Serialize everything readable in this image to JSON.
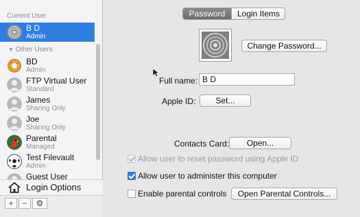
{
  "sidebar": {
    "current_user_label": "Current User",
    "other_users_label": "Other Users",
    "current_user": {
      "name": "B D",
      "role": "Admin",
      "avatar": "spiral-stone-avatar"
    },
    "other_users": [
      {
        "name": "BD",
        "role": "Admin",
        "avatar": "donut-avatar"
      },
      {
        "name": "FTP Virtual User",
        "role": "Standard",
        "avatar": "generic-person-avatar"
      },
      {
        "name": "James",
        "role": "Sharing Only",
        "avatar": "generic-person-avatar"
      },
      {
        "name": "Joe",
        "role": "Sharing Only",
        "avatar": "generic-person-avatar"
      },
      {
        "name": "Parental",
        "role": "Managed",
        "avatar": "parrot-avatar"
      },
      {
        "name": "Test Filevault",
        "role": "Admin",
        "avatar": "soccer-ball-avatar"
      },
      {
        "name": "Guest User",
        "role": "",
        "avatar": "generic-person-avatar"
      }
    ],
    "login_options_label": "Login Options",
    "add_label": "+",
    "remove_label": "−",
    "gear_label": "⚙"
  },
  "tabs": {
    "password": "Password",
    "login_items": "Login Items",
    "selected": "Password"
  },
  "main": {
    "change_password_label": "Change Password...",
    "full_name_label": "Full name:",
    "full_name_value": "B D",
    "apple_id_label": "Apple ID:",
    "set_label": "Set...",
    "contacts_card_label": "Contacts Card:",
    "open_label": "Open...",
    "allow_reset_label": "Allow user to reset password using Apple ID",
    "allow_reset_checked": true,
    "allow_reset_enabled": false,
    "allow_admin_label": "Allow user to administer this computer",
    "allow_admin_checked": true,
    "enable_parental_label": "Enable parental controls",
    "enable_parental_checked": false,
    "open_parental_label": "Open Parental Controls..."
  },
  "colors": {
    "selection": "#2f7ee0",
    "checkbox_accent": "#3a7ddf"
  }
}
